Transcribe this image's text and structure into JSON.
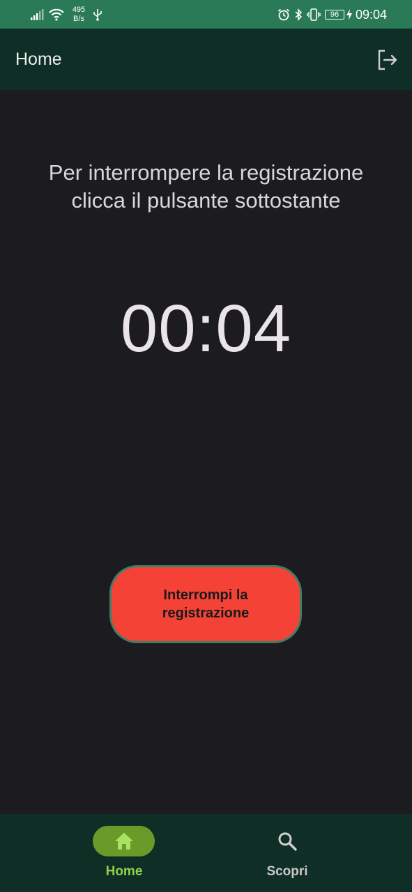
{
  "status_bar": {
    "net_speed_value": "495",
    "net_speed_unit": "B/s",
    "battery": "96",
    "time": "09:04",
    "icons": [
      "signal-icon",
      "wifi-icon",
      "usb-icon",
      "alarm-icon",
      "bluetooth-icon",
      "vibrate-icon",
      "battery-icon",
      "charging-icon"
    ]
  },
  "app_bar": {
    "title": "Home",
    "action_icon": "logout-icon"
  },
  "main": {
    "instruction_line1": "Per interrompere la registrazione",
    "instruction_line2": "clicca il pulsante sottostante",
    "timer": "00:04",
    "stop_button_label": "Interrompi la registrazione"
  },
  "bottom_nav": {
    "items": [
      {
        "label": "Home",
        "icon": "home-icon",
        "active": true
      },
      {
        "label": "Scopri",
        "icon": "search-icon",
        "active": false
      }
    ]
  },
  "colors": {
    "status_bar": "#2a7a57",
    "app_bar": "#0f2e25",
    "background": "#1c1b1f",
    "stop_button": "#f44336",
    "stop_button_border": "#3f7d66",
    "nav_active_pill": "#6a9a2a",
    "nav_active_label": "#8fd14f"
  }
}
